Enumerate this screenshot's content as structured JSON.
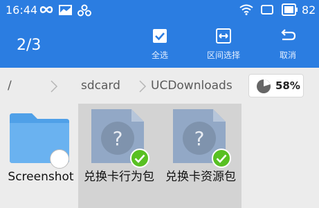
{
  "status_bar": {
    "time": "16:44",
    "battery": "82",
    "icons": [
      "infinity-icon",
      "mail-icon",
      "network-icon",
      "wifi-icon",
      "rotate-icon",
      "battery-icon"
    ]
  },
  "toolbar": {
    "selection_count": "2/3",
    "actions": [
      {
        "label": "全选",
        "icon": "select-all-icon"
      },
      {
        "label": "区间选择",
        "icon": "range-select-icon"
      },
      {
        "label": "取消",
        "icon": "cancel-return-icon"
      }
    ],
    "accent_color": "#2b7de1"
  },
  "breadcrumb": {
    "items": [
      "/",
      "sdcard",
      "UCDownloads"
    ],
    "storage_percent": "58%"
  },
  "files": [
    {
      "name": "Screenshot",
      "type": "folder",
      "selected": false
    },
    {
      "name": "兑换卡行为包",
      "type": "unknown-file",
      "selected": true
    },
    {
      "name": "兑换卡资源包",
      "type": "unknown-file",
      "selected": true
    }
  ]
}
